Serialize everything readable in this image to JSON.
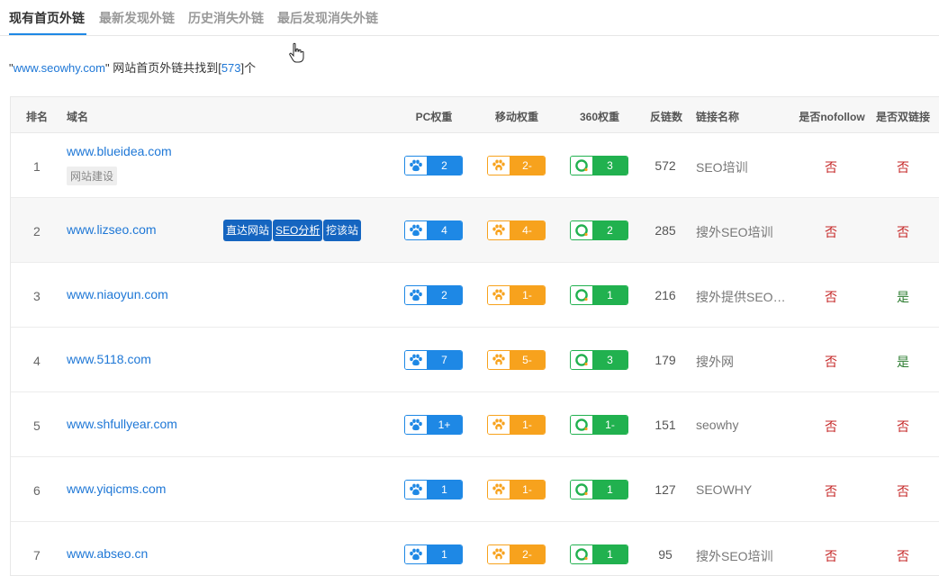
{
  "tabs": [
    {
      "label": "现有首页外链",
      "active": true
    },
    {
      "label": "最新发现外链",
      "active": false
    },
    {
      "label": "历史消失外链",
      "active": false
    },
    {
      "label": "最后发现消失外链",
      "active": false
    }
  ],
  "summary": {
    "q_open": "\"",
    "site": "www.seowhy.com",
    "q_close": "\"",
    "text": " 网站首页外链共找到[",
    "count": "573",
    "suffix": "]个"
  },
  "headers": {
    "rank": "排名",
    "domain": "域名",
    "pc": "PC权重",
    "mobile": "移动权重",
    "w360": "360权重",
    "backlinks": "反链数",
    "link_name": "链接名称",
    "nofollow": "是否nofollow",
    "double": "是否双链接"
  },
  "row_actions": {
    "visit": "直达网站",
    "seo": "SEO分析",
    "dig": "挖该站"
  },
  "colors": {
    "pc": "#1e88e5",
    "mobile": "#f7a21d",
    "w360": "#21b14f",
    "link": "#1e77d6",
    "no": "#c62828",
    "yes": "#2e7d32"
  },
  "icons": {
    "pc": "baidu-paw-icon",
    "mobile": "baidu-mobile-paw-icon",
    "w360": "360-ring-icon",
    "cursor": "hand-pointer-icon"
  },
  "rows": [
    {
      "rank": "1",
      "domain": "www.blueideа.com",
      "tag": "网站建设",
      "pc": "2",
      "mobile": "2-",
      "w360": "3",
      "backlinks": "572",
      "link_name": "SEO培训",
      "nofollow": "否",
      "double": "否"
    },
    {
      "rank": "2",
      "domain": "www.lizseo.com",
      "tag": "",
      "pc": "4",
      "mobile": "4-",
      "w360": "2",
      "backlinks": "285",
      "link_name": "搜外SEO培训",
      "nofollow": "否",
      "double": "否"
    },
    {
      "rank": "3",
      "domain": "www.niaoyun.com",
      "tag": "",
      "pc": "2",
      "mobile": "1-",
      "w360": "1",
      "backlinks": "216",
      "link_name": "搜外提供SEO…",
      "nofollow": "否",
      "double": "是"
    },
    {
      "rank": "4",
      "domain": "www.5118.com",
      "tag": "",
      "pc": "7",
      "mobile": "5-",
      "w360": "3",
      "backlinks": "179",
      "link_name": "搜外网",
      "nofollow": "否",
      "double": "是"
    },
    {
      "rank": "5",
      "domain": "www.shfullyear.com",
      "tag": "",
      "pc": "1+",
      "mobile": "1-",
      "w360": "1-",
      "backlinks": "151",
      "link_name": "seowhy",
      "nofollow": "否",
      "double": "否"
    },
    {
      "rank": "6",
      "domain": "www.yiqicms.com",
      "tag": "",
      "pc": "1",
      "mobile": "1-",
      "w360": "1",
      "backlinks": "127",
      "link_name": "SEOWHY",
      "nofollow": "否",
      "double": "否"
    },
    {
      "rank": "7",
      "domain": "www.abseo.cn",
      "tag": "",
      "pc": "1",
      "mobile": "2-",
      "w360": "1",
      "backlinks": "95",
      "link_name": "搜外SEO培训",
      "nofollow": "否",
      "double": "否"
    }
  ]
}
